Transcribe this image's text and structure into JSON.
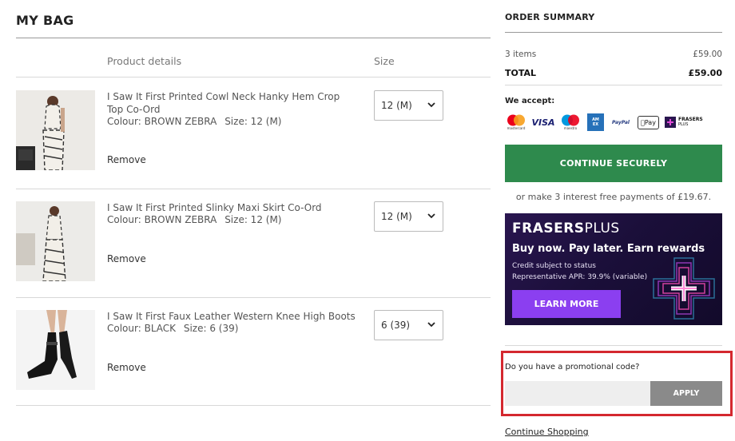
{
  "bag": {
    "title": "MY BAG",
    "headers": {
      "product": "Product details",
      "size": "Size"
    },
    "items": [
      {
        "name": "I Saw It First Printed Cowl Neck Hanky Hem Crop Top Co-Ord",
        "colour": "Colour: BROWN ZEBRA",
        "size_label": "Size: 12 (M)",
        "selected_size": "12 (M)",
        "remove": "Remove"
      },
      {
        "name": "I Saw It First Printed Slinky Maxi Skirt Co-Ord",
        "colour": "Colour: BROWN ZEBRA",
        "size_label": "Size: 12 (M)",
        "selected_size": "12 (M)",
        "remove": "Remove"
      },
      {
        "name": "I Saw It First Faux Leather Western Knee High Boots",
        "colour": "Colour: BLACK",
        "size_label": "Size: 6 (39)",
        "selected_size": "6 (39)",
        "remove": "Remove"
      }
    ]
  },
  "summary": {
    "title": "ORDER SUMMARY",
    "items_label": "3 items",
    "items_value": "£59.00",
    "total_label": "TOTAL",
    "total_value": "£59.00",
    "we_accept": "We accept:",
    "payment_methods": [
      {
        "icon": "mastercard-icon",
        "caption": "mastercard"
      },
      {
        "icon": "visa-icon",
        "text": "VISA"
      },
      {
        "icon": "maestro-icon",
        "caption": "maestro"
      },
      {
        "icon": "amex-icon",
        "text": "AM EX"
      },
      {
        "icon": "paypal-icon",
        "text": "PayPal"
      },
      {
        "icon": "apple-pay-icon",
        "text": "Pay"
      },
      {
        "icon": "frasers-plus-icon",
        "text": "FRASERS",
        "text2": "PLUS"
      }
    ],
    "continue_button": "CONTINUE SECURELY",
    "interest_text": "or make 3 interest free payments of £19.67."
  },
  "banner": {
    "logo_bold": "FRASERS",
    "logo_light": "PLUS",
    "headline": "Buy now. Pay later. Earn rewards",
    "sub1": "Credit subject to status",
    "sub2": "Representative APR: 39.9% (variable)",
    "button": "LEARN MORE"
  },
  "promo": {
    "label": "Do you have a promotional code?",
    "input_value": "",
    "apply": "APPLY"
  },
  "continue_shopping": "Continue Shopping",
  "colors": {
    "continue_green": "#2e8a4d",
    "learn_more_purple": "#8b3ff0",
    "promo_highlight": "#d4282f",
    "apply_grey": "#8a8a8a"
  }
}
